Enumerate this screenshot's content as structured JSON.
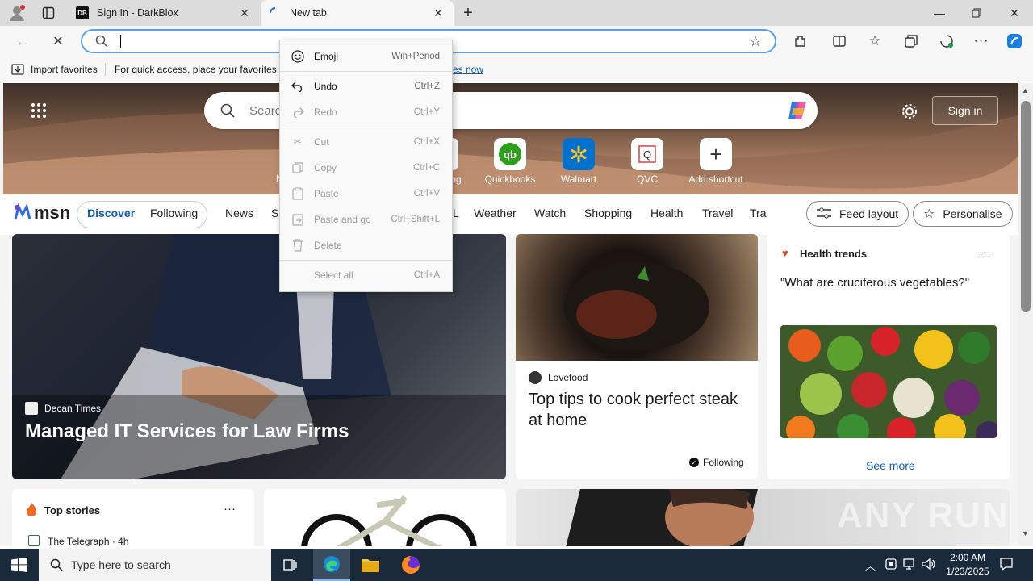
{
  "browser": {
    "tabs": [
      {
        "title": "Sign In - DarkBlox",
        "favicon": "DB"
      },
      {
        "title": "New tab"
      }
    ],
    "address": {
      "value": "",
      "placeholder": ""
    },
    "favorites_bar": {
      "import_label": "Import favorites",
      "message": "For quick access, place your favorites h",
      "link_tail": "es now"
    }
  },
  "context_menu": {
    "items": [
      {
        "label": "Emoji",
        "shortcut": "Win+Period",
        "enabled": true
      },
      {
        "label": "Undo",
        "shortcut": "Ctrl+Z",
        "enabled": true
      },
      {
        "label": "Redo",
        "shortcut": "Ctrl+Y",
        "enabled": false
      },
      {
        "label": "Cut",
        "shortcut": "Ctrl+X",
        "enabled": false
      },
      {
        "label": "Copy",
        "shortcut": "Ctrl+C",
        "enabled": false
      },
      {
        "label": "Paste",
        "shortcut": "Ctrl+V",
        "enabled": false
      },
      {
        "label": "Paste and go",
        "shortcut": "Ctrl+Shift+L",
        "enabled": false
      },
      {
        "label": "Delete",
        "shortcut": "",
        "enabled": false
      },
      {
        "label": "Select all",
        "shortcut": "Ctrl+A",
        "enabled": false
      }
    ]
  },
  "newtab": {
    "search_placeholder": "Searc",
    "sign_in": "Sign in",
    "shortcuts": [
      {
        "label": "ng",
        "icon": "partial-tile"
      },
      {
        "label": "Quickbooks",
        "icon": "quickbooks-icon"
      },
      {
        "label": "Walmart",
        "icon": "walmart-icon"
      },
      {
        "label": "QVC",
        "icon": "qvc-icon"
      },
      {
        "label": "Add shortcut",
        "icon": "plus-icon"
      }
    ],
    "partial_left_label": "N",
    "msn": {
      "logo": "msn",
      "tabs": [
        "Discover",
        "Following"
      ],
      "nav": [
        "News",
        "Sp",
        "L",
        "Weather",
        "Watch",
        "Shopping",
        "Health",
        "Travel",
        "Tra"
      ],
      "feed_layout": "Feed layout",
      "personalise": "Personalise"
    },
    "cards": {
      "hero": {
        "source": "Decan Times",
        "title": "Managed IT Services for Law Firms"
      },
      "steak": {
        "source": "Lovefood",
        "title": "Top tips to cook perfect steak at home",
        "following": "Following"
      },
      "health": {
        "header": "Health trends",
        "question": "\"What are cruciferous vegetables?\"",
        "see_more": "See more"
      },
      "top_stories": {
        "header": "Top stories",
        "first_source": "The Telegraph · 4h"
      }
    },
    "watermark": "ANY RUN"
  },
  "taskbar": {
    "search_placeholder": "Type here to search",
    "time": "2:00 AM",
    "date": "1/23/2025"
  }
}
